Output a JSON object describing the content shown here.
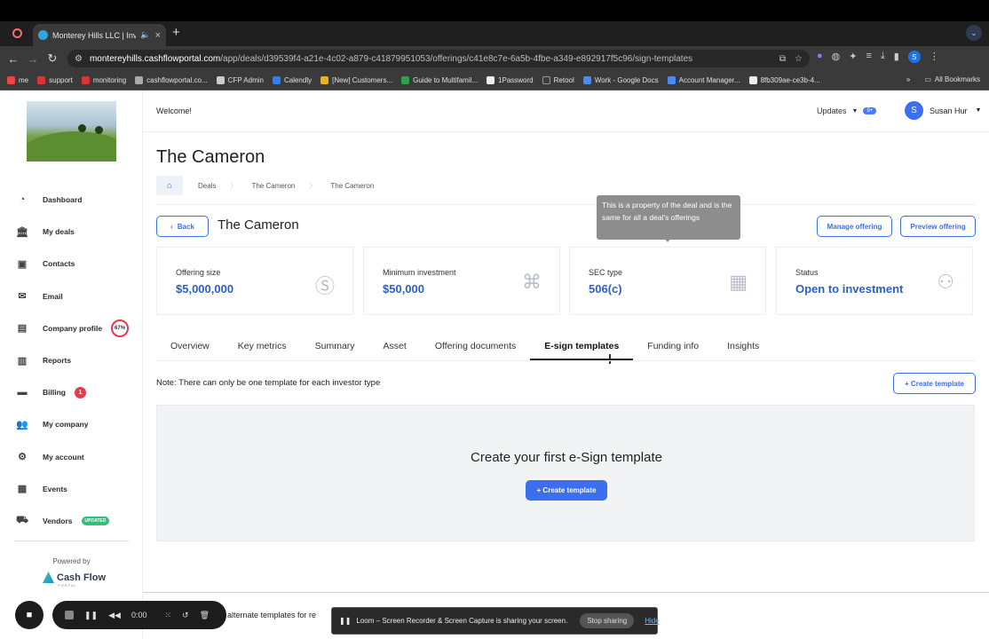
{
  "browser": {
    "tab_title": "Monterey Hills LLC | Invest",
    "url_host": "montereyhills.cashflowportal.com",
    "url_path": "/app/deals/d39539f4-a21e-4c02-a879-c41879951053/offerings/c41e8c7e-6a5b-4fbe-a349-e892917f5c96/sign-templates",
    "profile_initial": "S",
    "bookmarks": [
      "me",
      "support",
      "monitoring",
      "cashflowportal.co...",
      "CFP Admin",
      "Calendly",
      "[New] Customers...",
      "Guide to Multifamil...",
      "1Password",
      "Retool",
      "Work - Google Docs",
      "Account Manager...",
      "8fb309ae-ce3b-4..."
    ],
    "all_bookmarks": "All Bookmarks"
  },
  "sidebar": {
    "items": [
      {
        "label": "Dashboard",
        "icon": "gauge-icon"
      },
      {
        "label": "My deals",
        "icon": "bank-icon"
      },
      {
        "label": "Contacts",
        "icon": "contacts-icon"
      },
      {
        "label": "Email",
        "icon": "mail-icon"
      },
      {
        "label": "Company profile",
        "icon": "building-icon",
        "badge": "67%"
      },
      {
        "label": "Reports",
        "icon": "bar-chart-icon"
      },
      {
        "label": "Billing",
        "icon": "card-icon",
        "badge": "1"
      },
      {
        "label": "My company",
        "icon": "users-icon"
      },
      {
        "label": "My account",
        "icon": "gear-icon"
      },
      {
        "label": "Events",
        "icon": "calendar-icon"
      },
      {
        "label": "Vendors",
        "icon": "truck-icon",
        "badge": "UPDATED"
      }
    ],
    "powered_by": "Powered by",
    "brand": "Cash Flow",
    "brand_sub": "PORTAL"
  },
  "header": {
    "welcome": "Welcome!",
    "updates": "Updates",
    "updates_badge": "9+",
    "user_initial": "S",
    "user_name": "Susan Hur"
  },
  "page": {
    "title": "The Cameron",
    "breadcrumbs": [
      "Deals",
      "The Cameron",
      "The Cameron"
    ],
    "back": "Back",
    "offering_name": "The Cameron",
    "manage_offering": "Manage offering",
    "preview_offering": "Preview offering",
    "tooltip": "This is a property of the deal and is the same for all a deal's offerings"
  },
  "cards": [
    {
      "label": "Offering size",
      "value": "$5,000,000",
      "icon": "dollar-icon"
    },
    {
      "label": "Minimum investment",
      "value": "$50,000",
      "icon": "network-icon"
    },
    {
      "label": "SEC type",
      "value": "506(c)",
      "icon": "office-building-icon"
    },
    {
      "label": "Status",
      "value": "Open to investment",
      "icon": "group-icon"
    }
  ],
  "tabs": [
    "Overview",
    "Key metrics",
    "Summary",
    "Asset",
    "Offering documents",
    "E-sign templates",
    "Funding info",
    "Insights"
  ],
  "active_tab": "E-sign templates",
  "note": "Note: There can only be one template for each investor type",
  "create_template_top": "+ Create template",
  "empty_title": "Create your first e-Sign template",
  "create_template_main": "+ Create template",
  "alt_text": "alternate templates for re",
  "recorder": {
    "time": "0:00"
  },
  "share_bar": {
    "message": "Loom – Screen Recorder & Screen Capture is sharing your screen.",
    "stop": "Stop sharing",
    "hide": "Hide"
  },
  "colors": {
    "accent": "#3b6ff0",
    "value_blue": "#2d5fc8",
    "danger": "#e23b4b",
    "success": "#30c07a"
  }
}
